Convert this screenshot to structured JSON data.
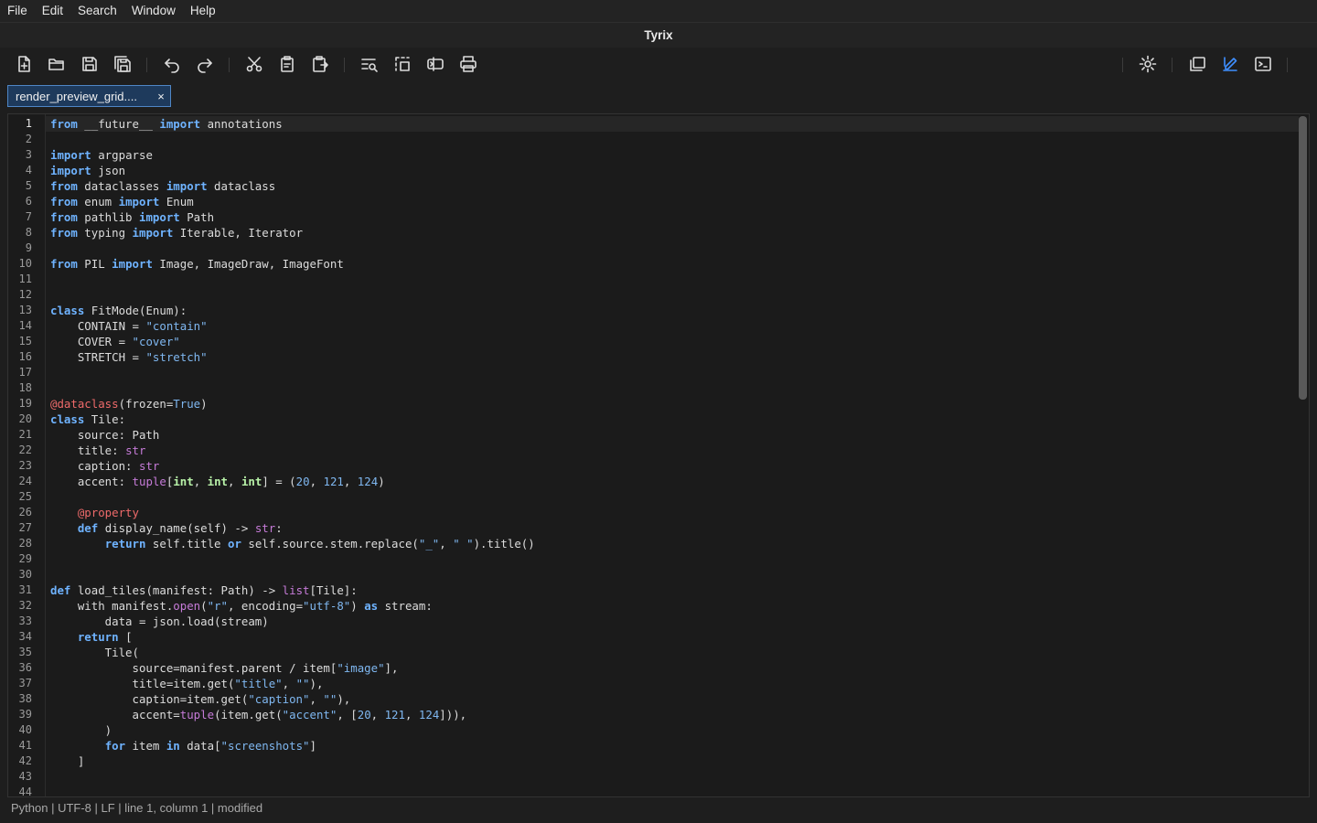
{
  "menubar": {
    "items": [
      "File",
      "Edit",
      "Search",
      "Window",
      "Help"
    ]
  },
  "window": {
    "title": "Tyrix"
  },
  "toolbar": {
    "left": [
      "new-file",
      "open-file",
      "save",
      "save-all",
      "undo",
      "redo",
      "cut",
      "copy",
      "paste",
      "find",
      "select-block",
      "indent",
      "print"
    ],
    "right": [
      "settings",
      "duplicate-window",
      "edit-mode",
      "terminal"
    ],
    "active": "edit-mode"
  },
  "tab": {
    "label": "render_preview_grid....",
    "close": "×"
  },
  "editor": {
    "current_line": 1,
    "lines": [
      "from __future__ import annotations",
      "",
      "import argparse",
      "import json",
      "from dataclasses import dataclass",
      "from enum import Enum",
      "from pathlib import Path",
      "from typing import Iterable, Iterator",
      "",
      "from PIL import Image, ImageDraw, ImageFont",
      "",
      "",
      "class FitMode(Enum):",
      "    CONTAIN = \"contain\"",
      "    COVER = \"cover\"",
      "    STRETCH = \"stretch\"",
      "",
      "",
      "@dataclass(frozen=True)",
      "class Tile:",
      "    source: Path",
      "    title: str",
      "    caption: str",
      "    accent: tuple[int, int, int] = (20, 121, 124)",
      "",
      "    @property",
      "    def display_name(self) -> str:",
      "        return self.title or self.source.stem.replace(\"_\", \" \").title()",
      "",
      "",
      "def load_tiles(manifest: Path) -> list[Tile]:",
      "    with manifest.open(\"r\", encoding=\"utf-8\") as stream:",
      "        data = json.load(stream)",
      "    return [",
      "        Tile(",
      "            source=manifest.parent / item[\"image\"],",
      "            title=item.get(\"title\", \"\"),",
      "            caption=item.get(\"caption\", \"\"),",
      "            accent=tuple(item.get(\"accent\", [20, 121, 124])),",
      "        )",
      "        for item in data[\"screenshots\"]",
      "    ]",
      "",
      ""
    ]
  },
  "statusbar": {
    "text": "Python | UTF-8 | LF | line 1, column 1 | modified"
  }
}
